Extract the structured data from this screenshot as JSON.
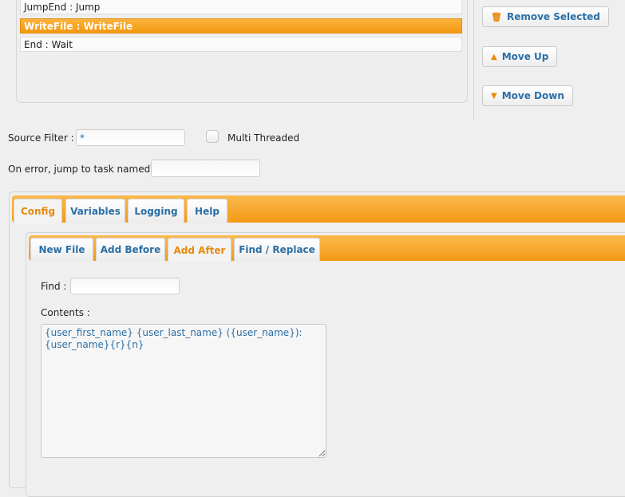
{
  "tasks": [
    {
      "label": "JumpEnd : Jump",
      "selected": false
    },
    {
      "label": "WriteFile : WriteFile",
      "selected": true
    },
    {
      "label": "End : Wait",
      "selected": false
    }
  ],
  "side_buttons": {
    "remove_selected": "Remove Selected",
    "move_up": "Move Up",
    "move_down": "Move Down"
  },
  "source_filter": {
    "label": "Source Filter :",
    "value": "*"
  },
  "multi_threaded": {
    "label": "Multi Threaded",
    "checked": false
  },
  "on_error": {
    "label": "On error, jump to task named :",
    "value": ""
  },
  "main_tabs": [
    {
      "label": "Config",
      "active": true
    },
    {
      "label": "Variables",
      "active": false
    },
    {
      "label": "Logging",
      "active": false
    },
    {
      "label": "Help",
      "active": false
    }
  ],
  "sub_tabs": [
    {
      "label": "New File",
      "active": false
    },
    {
      "label": "Add Before",
      "active": false
    },
    {
      "label": "Add After",
      "active": true
    },
    {
      "label": "Find / Replace",
      "active": false
    }
  ],
  "find": {
    "label": "Find :",
    "value": ""
  },
  "contents": {
    "label": "Contents :",
    "value": "{user_first_name} {user_last_name} ({user_name}):\n{user_name}{r}{n}"
  },
  "colors": {
    "accent_orange": "#f4990f",
    "link_blue": "#2b6fa6"
  }
}
